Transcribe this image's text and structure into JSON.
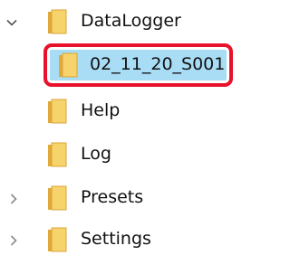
{
  "tree": {
    "items": [
      {
        "label": "DataLogger",
        "expanded": true,
        "icon": "folder-icon",
        "chevron": "chevron-down-icon"
      },
      {
        "label": "02_11_20_S001",
        "selected": true,
        "highlighted": true,
        "icon": "folder-icon"
      },
      {
        "label": "Help",
        "icon": "folder-icon"
      },
      {
        "label": "Log",
        "icon": "folder-icon"
      },
      {
        "label": "Presets",
        "expanded": false,
        "icon": "folder-icon",
        "chevron": "chevron-right-icon"
      },
      {
        "label": "Settings",
        "expanded": false,
        "icon": "folder-icon",
        "chevron": "chevron-right-icon"
      }
    ]
  },
  "colors": {
    "folder_fill": "#f6d36b",
    "folder_back": "#e0a93a",
    "selection_bg": "#a9dcf5",
    "highlight_border": "#e8122c",
    "chevron": "#7a7a7a",
    "text": "#111111"
  }
}
